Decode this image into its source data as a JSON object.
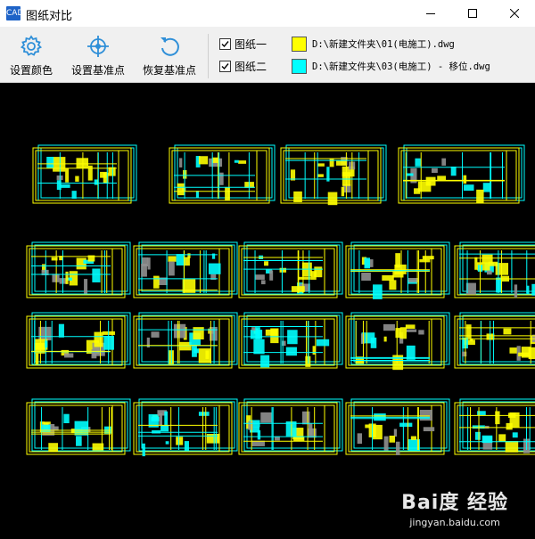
{
  "window": {
    "title": "图纸对比",
    "app_icon_text": "CAD"
  },
  "toolbar": {
    "set_color_label": "设置颜色",
    "set_base_point_label": "设置基准点",
    "restore_base_point_label": "恢复基准点"
  },
  "layers": [
    {
      "label": "图纸一",
      "checked": true,
      "color": "#ffff00",
      "path": "D:\\新建文件夹\\01(电施工).dwg"
    },
    {
      "label": "图纸二",
      "checked": true,
      "color": "#00ffff",
      "path": "D:\\新建文件夹\\03(电施工) - 移位.dwg"
    }
  ],
  "canvas": {
    "background": "#000000",
    "color_a": "#ffff00",
    "color_b": "#00ffff",
    "gray": "#909090"
  },
  "watermark": {
    "logo": "Bai度 经验",
    "url": "jingyan.baidu.com"
  }
}
